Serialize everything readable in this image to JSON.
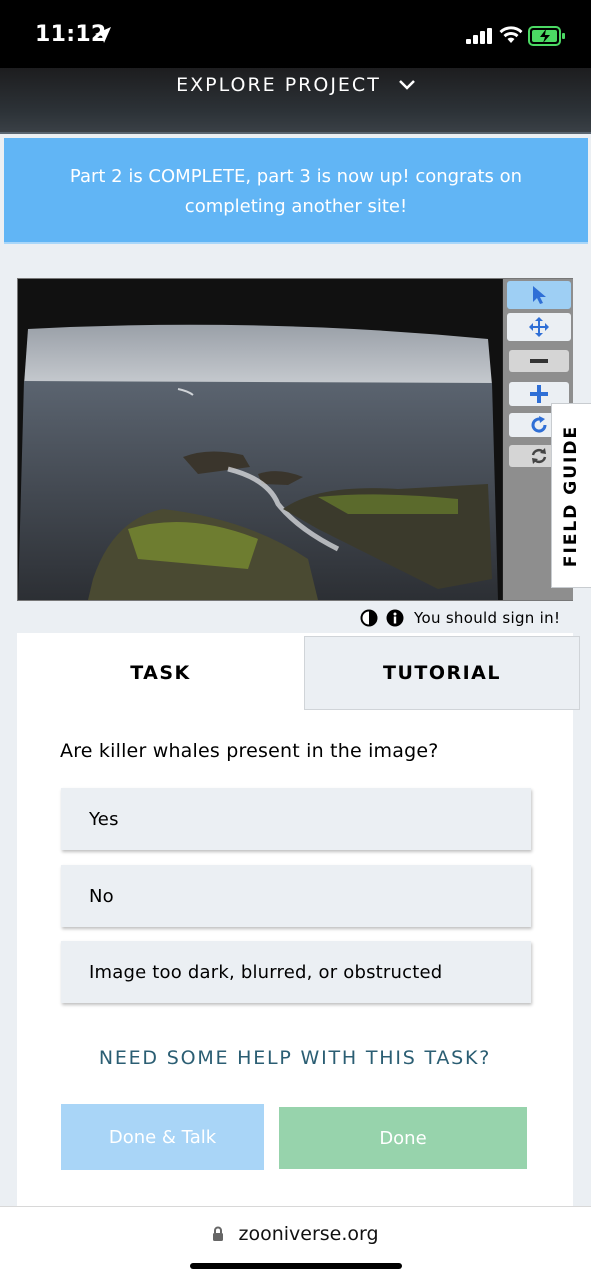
{
  "status_bar": {
    "time": "11:12",
    "icons": [
      "location-arrow-icon",
      "signal-icon",
      "wifi-icon",
      "battery-charging-icon"
    ]
  },
  "header": {
    "title": "EXPLORE PROJECT",
    "dropdown_icon": "chevron-down-icon"
  },
  "announcement": {
    "text": "Part 2 is COMPLETE, part 3 is now up! congrats on completing another site!"
  },
  "viewer": {
    "image_alt": "rocky coastline with grassy rocks and grey sea",
    "tools": [
      "pointer-icon",
      "move-icon",
      "zoom-out-icon",
      "zoom-in-icon",
      "rotate-icon",
      "reset-icon"
    ]
  },
  "field_guide": {
    "label": "FIELD GUIDE"
  },
  "meta": {
    "sign_in_text": "You should sign in!",
    "icons": [
      "contrast-icon",
      "info-icon"
    ]
  },
  "tabs": {
    "task": "TASK",
    "tutorial": "TUTORIAL"
  },
  "task": {
    "question": "Are killer whales present in the image?",
    "answers": [
      "Yes",
      "No",
      "Image too dark, blurred, or obstructed"
    ],
    "help_link": "NEED SOME HELP WITH THIS TASK?",
    "done_talk": "Done & Talk",
    "done": "Done"
  },
  "browser": {
    "url": "zooniverse.org"
  },
  "colors": {
    "announcement_bg": "#61b5f5",
    "done_green": "#97d3ac",
    "talk_blue": "#a9d5f7",
    "link_teal": "#2b5e73"
  }
}
